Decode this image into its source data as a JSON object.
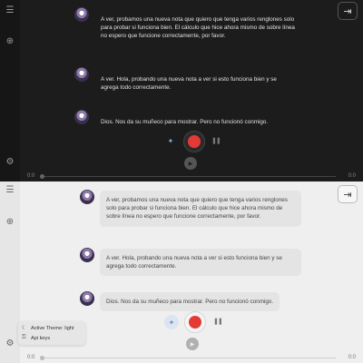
{
  "messages": [
    "A ver, probamos una nueva nota que quiero que tenga varios renglones solo para probar si funciona bien. El cálculo que hice ahora mismo de sobre línea no espero que funcione correctamente, por favor.",
    "A ver. Hola, probando una nueva nota a ver si esto funciona bien y se agrega todo correctamente.",
    "Dios. Nos da su muñeco para mostrar. Pero no funcionó conmigo."
  ],
  "player": {
    "time_start": "0:0",
    "time_end": "0:0"
  },
  "menu": {
    "theme_label": "Active Theme: light",
    "api_keys_label": "Api keys"
  },
  "icons": {
    "menu": "menu-icon",
    "add": "add-circle-icon",
    "settings": "gear-icon",
    "exit": "exit-icon",
    "mic": "microphone-icon",
    "record": "record-icon",
    "pause": "pause-icon",
    "play": "play-icon",
    "theme": "moon-icon",
    "key": "key-icon"
  },
  "colors": {
    "record": "#e53935",
    "dark_bg": "#1c1c1c",
    "light_bg": "#efefef",
    "accent": "#6e8fc4"
  }
}
